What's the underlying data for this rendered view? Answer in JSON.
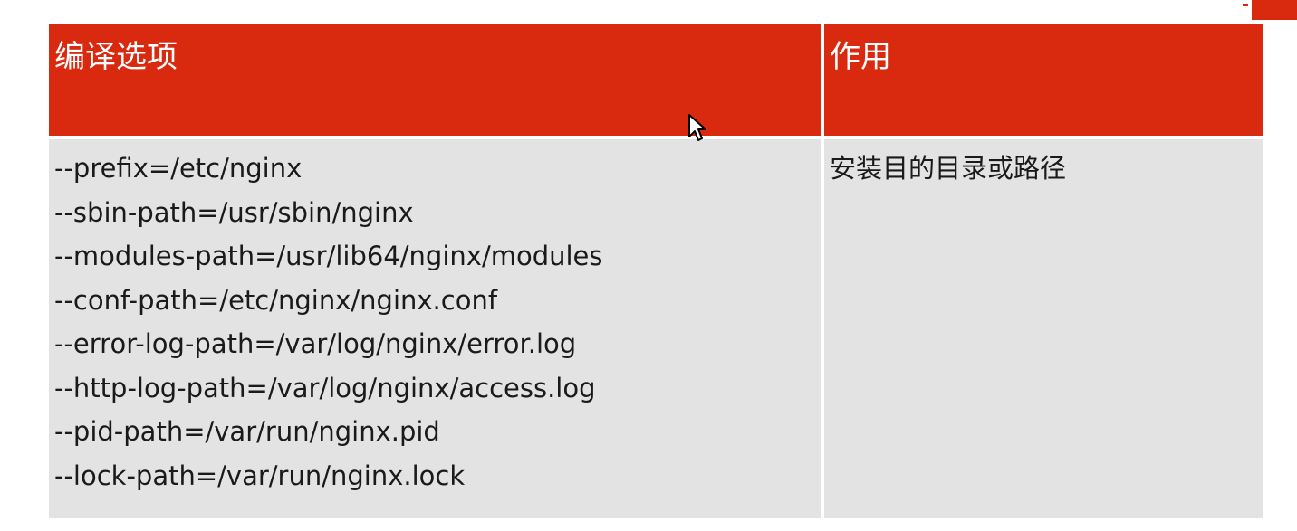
{
  "table": {
    "headers": [
      "编译选项",
      "作用"
    ],
    "rows": [
      {
        "options": [
          "--prefix=/etc/nginx",
          "--sbin-path=/usr/sbin/nginx",
          "--modules-path=/usr/lib64/nginx/modules",
          "--conf-path=/etc/nginx/nginx.conf",
          "--error-log-path=/var/log/nginx/error.log",
          "--http-log-path=/var/log/nginx/access.log",
          "--pid-path=/var/run/nginx.pid",
          "--lock-path=/var/run/nginx.lock"
        ],
        "purpose": "安装目的目录或路径"
      }
    ]
  },
  "colors": {
    "header_bg": "#d92a10",
    "body_bg": "#e3e3e3",
    "header_text": "#ffffff",
    "body_text": "#1a1a1a"
  },
  "icons": {
    "cursor": "mouse-pointer-icon",
    "logo": "brand-logo-icon"
  }
}
